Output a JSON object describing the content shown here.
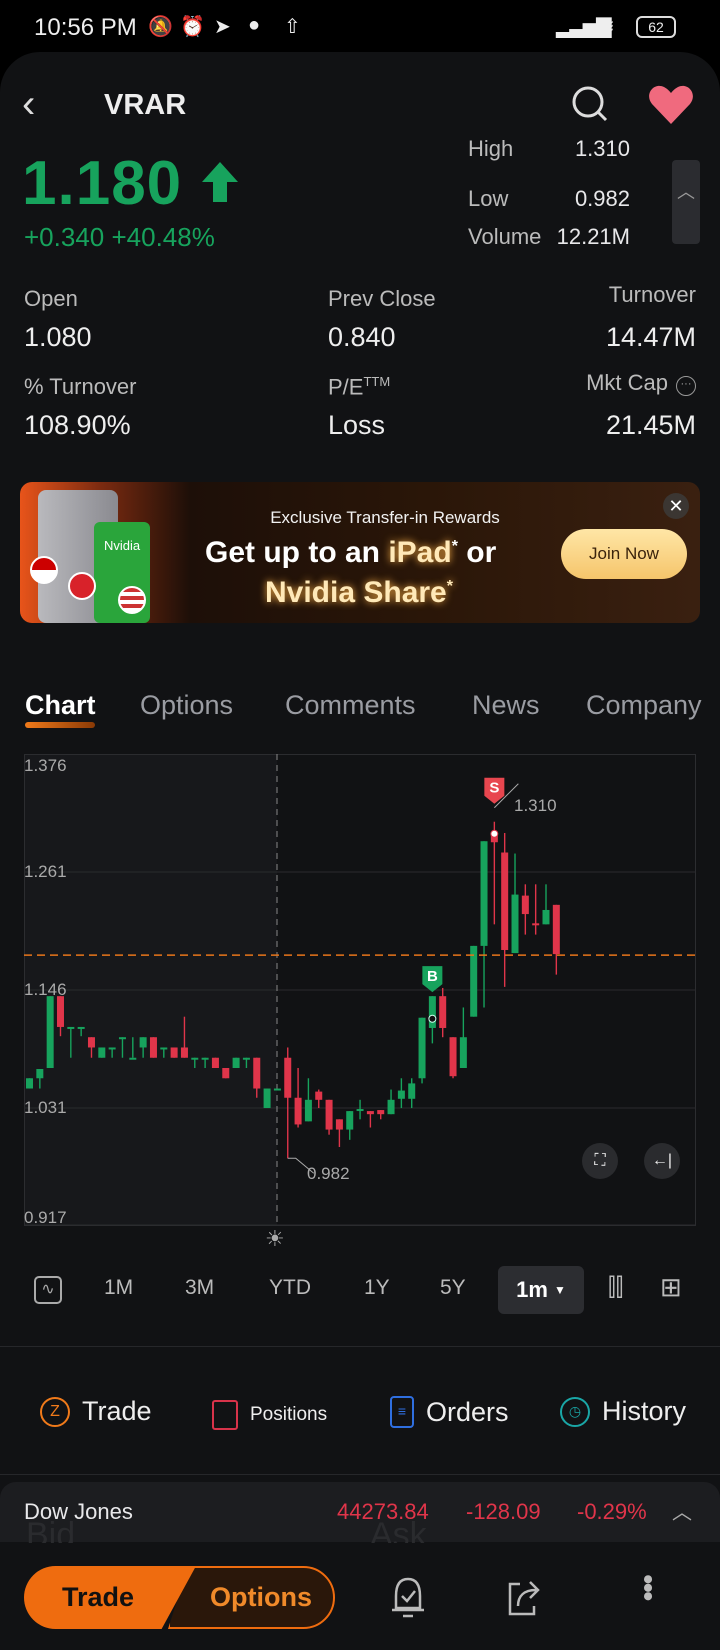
{
  "status_bar": {
    "time": "10:56 PM",
    "battery": "62"
  },
  "header": {
    "ticker": "VRAR"
  },
  "quote": {
    "price": "1.180",
    "change": "+0.340 +40.48%",
    "side_stats": [
      {
        "label": "High",
        "value": "1.310"
      },
      {
        "label": "Low",
        "value": "0.982"
      },
      {
        "label": "Volume",
        "value": "12.21M"
      }
    ],
    "stats": [
      {
        "label": "Open",
        "value": "1.080"
      },
      {
        "label": "Prev Close",
        "value": "0.840"
      },
      {
        "label": "Turnover",
        "value": "14.47M"
      },
      {
        "label": "% Turnover",
        "value": "108.90%"
      },
      {
        "label": "P/E",
        "label_sup": "TTM",
        "value": "Loss"
      },
      {
        "label": "Mkt Cap",
        "value": "21.45M"
      }
    ]
  },
  "banner": {
    "subtitle": "Exclusive Transfer-in Rewards",
    "line1_a": "Get up to an ",
    "line1_b": "iPad",
    "line1_c": " or",
    "line2": "Nvidia Share",
    "asterisk": "*",
    "join_label": "Join Now",
    "product_label": "Nvidia"
  },
  "tabs": [
    {
      "label": "Chart",
      "active": true
    },
    {
      "label": "Options"
    },
    {
      "label": "Comments"
    },
    {
      "label": "News"
    },
    {
      "label": "Company"
    }
  ],
  "chart_data": {
    "type": "candlestick",
    "interval": "1m",
    "ylim": [
      0.917,
      1.376
    ],
    "y_ticks": [
      "1.376",
      "1.261",
      "1.146",
      "1.031",
      "0.917"
    ],
    "grid": true,
    "last_price_line": 1.18,
    "high_label": "1.310",
    "low_label": "0.982",
    "buy_marker": "B",
    "sell_marker": "S",
    "colors": {
      "up": "#17a35d",
      "down": "#e0354a",
      "last_price": "#f07a1a"
    },
    "candles_ohlc": [
      [
        1.05,
        1.06,
        1.05,
        1.06
      ],
      [
        1.06,
        1.069,
        1.05,
        1.069
      ],
      [
        1.07,
        1.14,
        1.07,
        1.14
      ],
      [
        1.14,
        1.14,
        1.101,
        1.11
      ],
      [
        1.11,
        1.11,
        1.08,
        1.11
      ],
      [
        1.11,
        1.11,
        1.101,
        1.11
      ],
      [
        1.1,
        1.1,
        1.08,
        1.09
      ],
      [
        1.08,
        1.09,
        1.08,
        1.09
      ],
      [
        1.09,
        1.09,
        1.08,
        1.09
      ],
      [
        1.1,
        1.1,
        1.08,
        1.1
      ],
      [
        1.08,
        1.1,
        1.08,
        1.08
      ],
      [
        1.09,
        1.1,
        1.08,
        1.1
      ],
      [
        1.1,
        1.1,
        1.08,
        1.08
      ],
      [
        1.09,
        1.09,
        1.08,
        1.09
      ],
      [
        1.09,
        1.09,
        1.08,
        1.08
      ],
      [
        1.09,
        1.12,
        1.08,
        1.08
      ],
      [
        1.08,
        1.08,
        1.07,
        1.08
      ],
      [
        1.08,
        1.08,
        1.07,
        1.08
      ],
      [
        1.08,
        1.08,
        1.07,
        1.07
      ],
      [
        1.07,
        1.07,
        1.06,
        1.06
      ],
      [
        1.07,
        1.08,
        1.07,
        1.08
      ],
      [
        1.08,
        1.08,
        1.07,
        1.08
      ],
      [
        1.08,
        1.08,
        1.041,
        1.05
      ],
      [
        1.031,
        1.05,
        1.031,
        1.05
      ],
      [
        1.05,
        1.05,
        1.05,
        1.05
      ],
      [
        1.08,
        1.09,
        0.982,
        1.041
      ],
      [
        1.041,
        1.07,
        1.012,
        1.015
      ],
      [
        1.018,
        1.06,
        1.018,
        1.039
      ],
      [
        1.047,
        1.049,
        1.031,
        1.039
      ],
      [
        1.039,
        1.039,
        1.005,
        1.01
      ],
      [
        1.02,
        1.02,
        0.993,
        1.01
      ],
      [
        1.01,
        1.028,
        1.0,
        1.028
      ],
      [
        1.03,
        1.039,
        1.02,
        1.03
      ],
      [
        1.028,
        1.028,
        1.012,
        1.025
      ],
      [
        1.029,
        1.029,
        1.02,
        1.025
      ],
      [
        1.025,
        1.049,
        1.025,
        1.039
      ],
      [
        1.04,
        1.06,
        1.031,
        1.048
      ],
      [
        1.04,
        1.06,
        1.031,
        1.055
      ],
      [
        1.06,
        1.119,
        1.055,
        1.119
      ],
      [
        1.109,
        1.14,
        1.094,
        1.14
      ],
      [
        1.14,
        1.148,
        1.1,
        1.109
      ],
      [
        1.1,
        1.1,
        1.06,
        1.062
      ],
      [
        1.07,
        1.129,
        1.07,
        1.1
      ],
      [
        1.12,
        1.189,
        1.12,
        1.189
      ],
      [
        1.189,
        1.291,
        1.129,
        1.291
      ],
      [
        1.299,
        1.31,
        1.21,
        1.29
      ],
      [
        1.28,
        1.299,
        1.149,
        1.185
      ],
      [
        1.182,
        1.279,
        1.182,
        1.239
      ],
      [
        1.238,
        1.249,
        1.2,
        1.22
      ],
      [
        1.211,
        1.249,
        1.2,
        1.21
      ],
      [
        1.21,
        1.249,
        1.21,
        1.224
      ],
      [
        1.229,
        1.229,
        1.161,
        1.181
      ]
    ]
  },
  "ranges": [
    "1M",
    "3M",
    "YTD",
    "1Y",
    "5Y"
  ],
  "selected_interval": "1m",
  "actions": [
    {
      "label": "Trade",
      "color": "#f07a1a"
    },
    {
      "label": "Positions",
      "color": "#d8334a"
    },
    {
      "label": "Orders",
      "color": "#2f6fe0"
    },
    {
      "label": "History",
      "color": "#1aa6a6"
    }
  ],
  "index_ticker": {
    "name": "Dow Jones",
    "value": "44273.84",
    "change": "-128.09",
    "percent": "-0.29%",
    "under_labels": [
      "Bid",
      "Ask"
    ]
  },
  "bottom_bar": {
    "trade_label": "Trade",
    "options_label": "Options"
  }
}
